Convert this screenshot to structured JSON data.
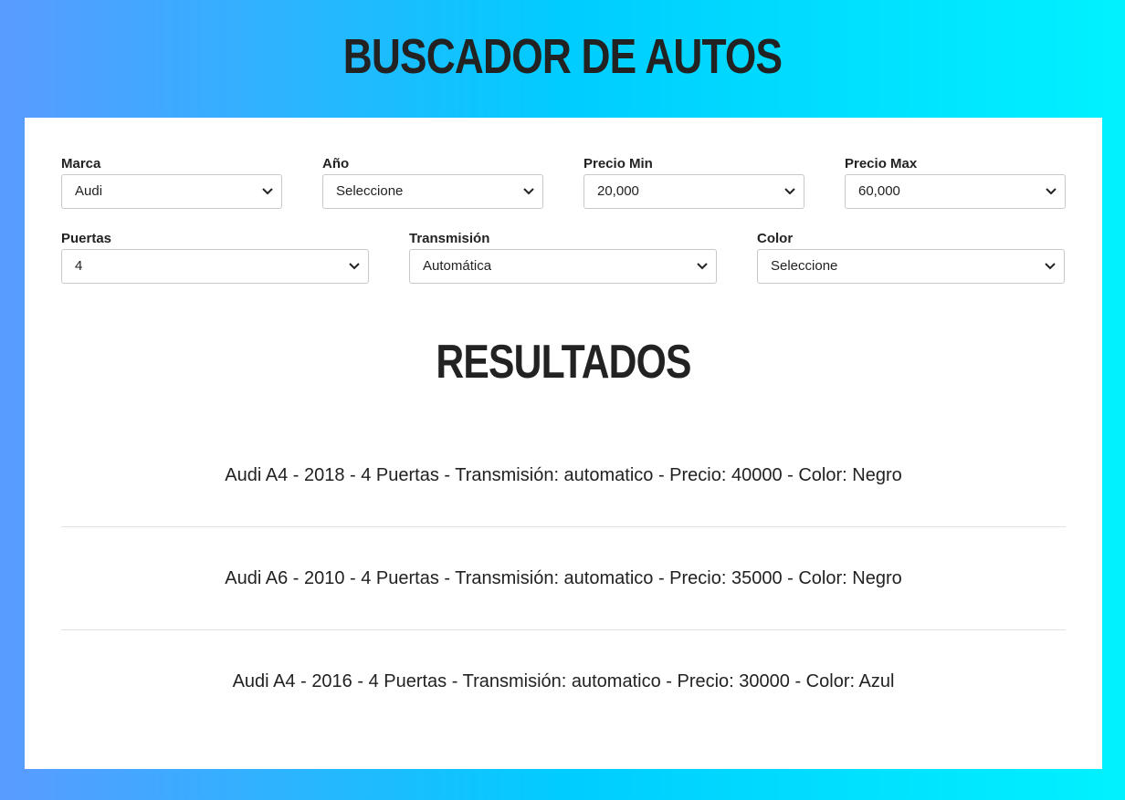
{
  "header": {
    "title": "Buscador de Autos"
  },
  "filters": {
    "row1": [
      {
        "label": "Marca",
        "value": "Audi"
      },
      {
        "label": "Año",
        "value": "Seleccione"
      },
      {
        "label": "Precio Min",
        "value": "20,000"
      },
      {
        "label": "Precio Max",
        "value": "60,000"
      }
    ],
    "row2": [
      {
        "label": "Puertas",
        "value": "4"
      },
      {
        "label": "Transmisión",
        "value": "Automática"
      },
      {
        "label": "Color",
        "value": "Seleccione"
      }
    ]
  },
  "results": {
    "title": "Resultados",
    "items": [
      "Audi A4 - 2018 - 4 Puertas - Transmisión: automatico - Precio: 40000 - Color: Negro",
      "Audi A6 - 2010 - 4 Puertas - Transmisión: automatico - Precio: 35000 - Color: Negro",
      "Audi A4 - 2016 - 4 Puertas - Transmisión: automatico - Precio: 30000 - Color: Azul"
    ]
  },
  "icons": {
    "select_arrow": "chevron-down-icon"
  },
  "colors": {
    "gradient_start": "#5a9bff",
    "gradient_mid": "#00ccff",
    "gradient_end": "#00f2ff",
    "text": "#222222"
  }
}
